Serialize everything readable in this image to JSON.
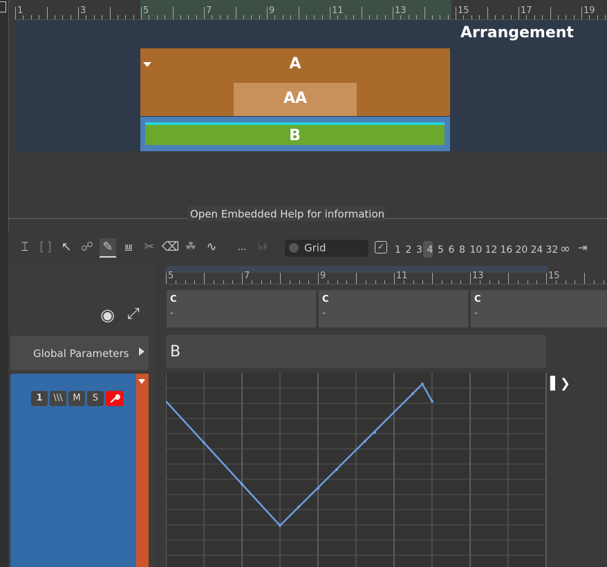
{
  "arrangement": {
    "title": "Arrangement",
    "ruler_labels": [
      "1",
      "3",
      "5",
      "7",
      "9",
      "11",
      "13",
      "15",
      "17",
      "19"
    ],
    "clips": {
      "a": "A",
      "aa": "AA",
      "b": "B"
    }
  },
  "help": {
    "text": "Open Embedded Help for information"
  },
  "toolbar": {
    "grid_label": "Grid",
    "divisions": [
      "1",
      "2",
      "3",
      "4",
      "5",
      "6",
      "8",
      "10",
      "12",
      "16",
      "20",
      "24",
      "32"
    ],
    "selected_division": "4",
    "more_label": "...",
    "sharp_label": "♭♯"
  },
  "left_panel": {
    "global_parameters": "Global Parameters",
    "track_buttons": [
      "1",
      "\\\\\\",
      "M",
      "S"
    ]
  },
  "editor": {
    "ruler_labels": [
      "5",
      "7",
      "9",
      "11",
      "13",
      "15"
    ],
    "chords": [
      {
        "name": "C",
        "sub": "-"
      },
      {
        "name": "C",
        "sub": "-"
      },
      {
        "name": "C",
        "sub": "-"
      }
    ],
    "clip_name": "B"
  },
  "colors": {
    "clip_a": "#aa6a2b",
    "clip_aa": "#c8915c",
    "clip_b": "#6aa82e",
    "track": "#336aa8",
    "track_accent": "#cc552b",
    "automation_line": "#6d9ee0"
  }
}
